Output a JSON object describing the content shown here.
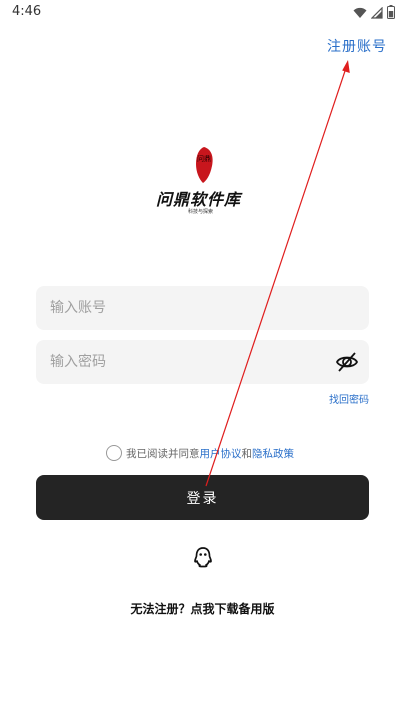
{
  "status_bar": {
    "time": "4:46",
    "icons": [
      "wifi-icon",
      "signal-icon",
      "battery-icon"
    ]
  },
  "header": {
    "register_label": "注册账号"
  },
  "logo": {
    "mark_text": "问鼎",
    "title": "问鼎软件库",
    "subtitle": "科技与探索"
  },
  "form": {
    "account_placeholder": "输入账号",
    "account_value": "",
    "password_placeholder": "输入密码",
    "password_value": "",
    "forgot_label": "找回密码"
  },
  "agreement": {
    "prefix": "我已阅读并同意",
    "user_agreement": "用户协议",
    "conjunction": "和",
    "privacy_policy": "隐私政策"
  },
  "login": {
    "button_label": "登录"
  },
  "social": {
    "icon": "qq-icon"
  },
  "footer": {
    "fallback_label": "无法注册？点我下载备用版"
  },
  "colors": {
    "accent": "#2a6fc9",
    "button": "#242424",
    "field_bg": "#f4f4f4",
    "logo_red": "#c8161d",
    "annotation": "#e01e1e"
  }
}
